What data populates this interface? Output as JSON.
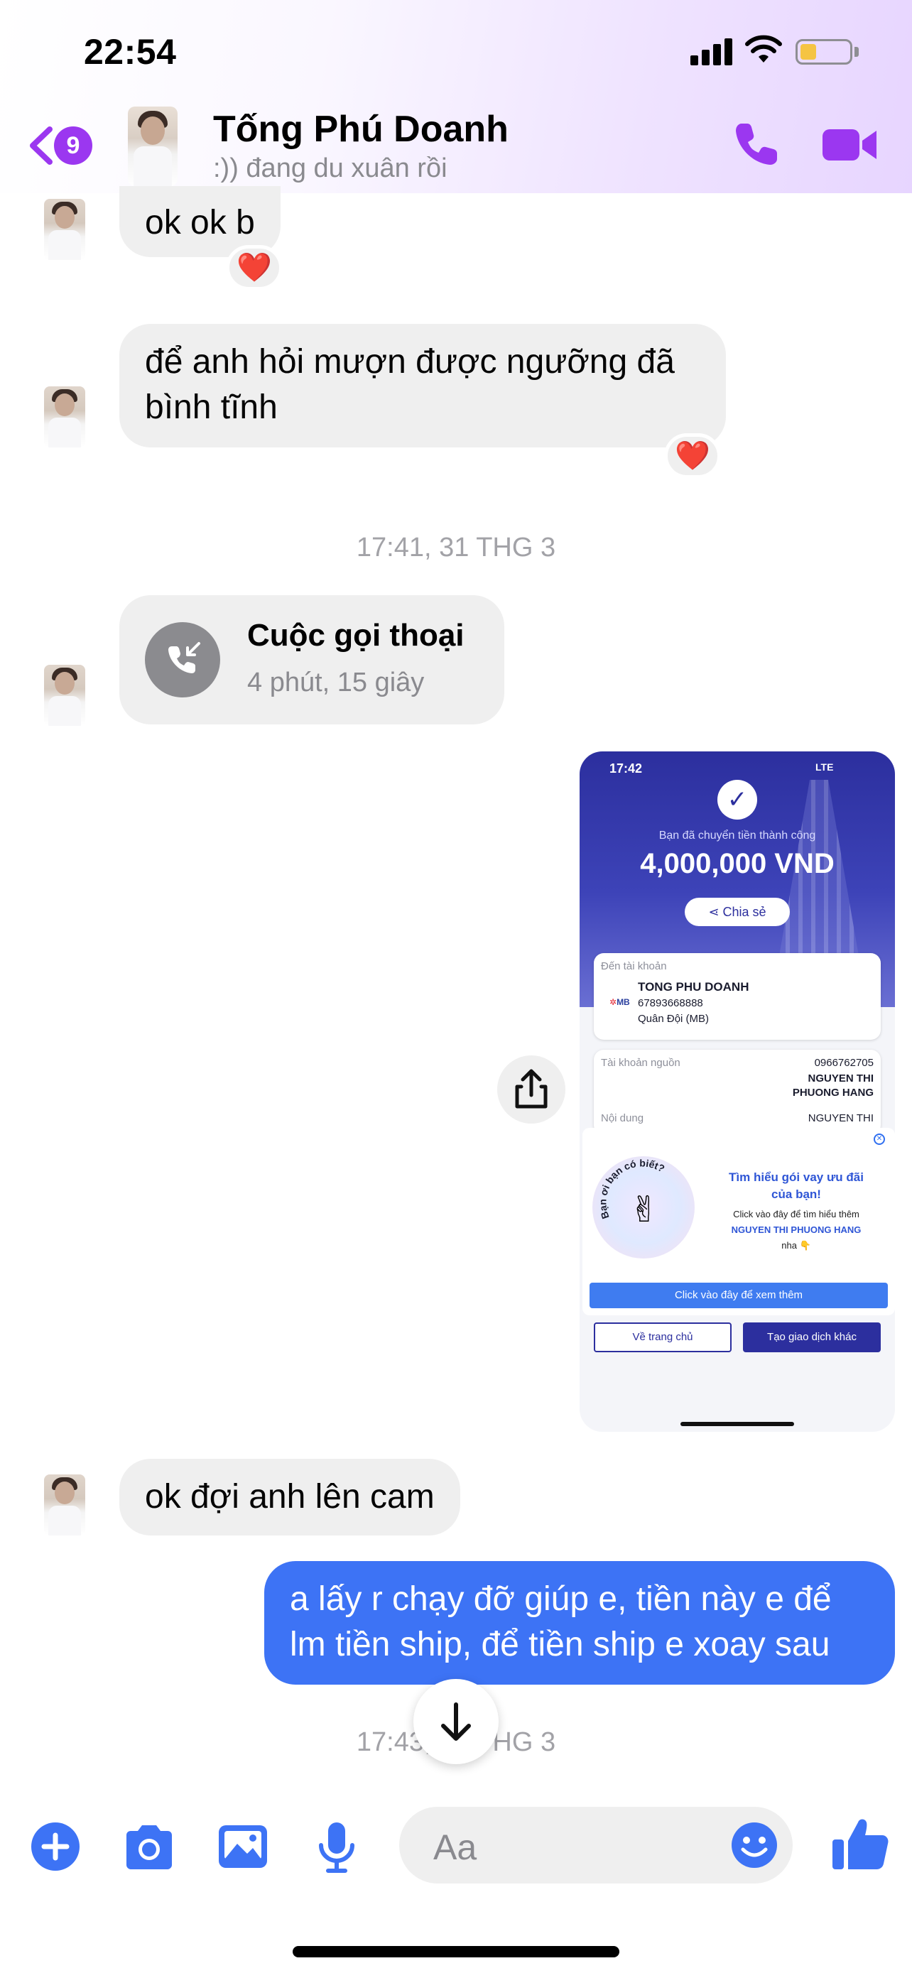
{
  "status_bar": {
    "time": "22:54"
  },
  "header": {
    "unread_count": "9",
    "contact_name": "Tống Phú Doanh",
    "contact_status": ":)) đang du xuân rồi"
  },
  "messages": {
    "m1": {
      "text": "ok ok b",
      "reaction": "❤️"
    },
    "m2": {
      "line1": "để anh hỏi mượn được ngưỡng đã",
      "line2": "bình tĩnh",
      "reaction": "❤️"
    },
    "timestamp1": "17:41, 31 THG 3",
    "call": {
      "title": "Cuộc gọi thoại",
      "duration": "4 phút, 15 giây"
    },
    "m4": {
      "text": "ok đợi anh lên cam"
    },
    "m5": {
      "line1": "a lấy r chạy đỡ giúp e, tiền này e để",
      "line2": "lm tiền ship, để tiền ship e xoay sau"
    },
    "timestamp2": "17:43, 31 THG 3"
  },
  "shared_image": {
    "time": "17:42",
    "network": "LTE",
    "success_text": "Bạn đã chuyển tiền thành công",
    "amount": "4,000,000 VND",
    "share_label": "Chia sẻ",
    "to_account_label": "Đến tài khoản",
    "recipient_name": "TONG PHU DOANH",
    "account_number": "67893668888",
    "bank": "Quân Đội (MB)",
    "bank_logo": "MB",
    "source_label": "Tài khoản nguồn",
    "source_number": "0966762705",
    "source_name_1": "NGUYEN THI",
    "source_name_2": "PHUONG HANG",
    "content_label": "Nội dung",
    "content_value": "NGUYEN THI",
    "promo_badge_text": "Bạn ơi bạn có biết?",
    "promo_title_1": "Tìm hiểu gói vay ưu đãi",
    "promo_title_2": "của bạn!",
    "promo_line_1": "Click vào đây để tìm hiểu thêm",
    "promo_line_2": "NGUYEN THI PHUONG HANG",
    "promo_line_3": "nha 👇",
    "promo_button": "Click vào đây để xem thêm",
    "home_button": "Về trang chủ",
    "new_transaction_button": "Tạo giao dịch khác"
  },
  "composer": {
    "placeholder": "Aa"
  },
  "colors": {
    "accent": "#9b37f0",
    "outgoing_bubble": "#3d73f5",
    "incoming_bubble": "#efefef",
    "composer_icon": "#3d73f5"
  }
}
